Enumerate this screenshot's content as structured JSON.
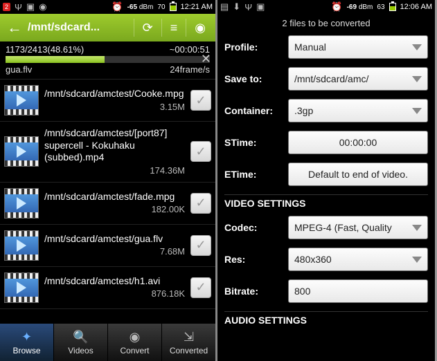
{
  "left": {
    "status": {
      "dbm": "-65",
      "dbm_unit": "dBm",
      "batt_pct": "70",
      "time": "12:21 AM",
      "badge": "2"
    },
    "nav": {
      "path": "/mnt/sdcard..."
    },
    "progress": {
      "count": "1173/2413(48.61%)",
      "eta": "~00:00:51",
      "pct": 48.61
    },
    "current": {
      "name": "gua.flv",
      "rate": "24frame/s"
    },
    "files": [
      {
        "path": "/mnt/sdcard/amctest/Cooke.mpg",
        "size": "3.15M"
      },
      {
        "path": "/mnt/sdcard/amctest/[port87] supercell - Kokuhaku (subbed).mp4",
        "size": "174.36M"
      },
      {
        "path": "/mnt/sdcard/amctest/fade.mpg",
        "size": "182.00K"
      },
      {
        "path": "/mnt/sdcard/amctest/gua.flv",
        "size": "7.68M"
      },
      {
        "path": "/mnt/sdcard/amctest/h1.avi",
        "size": "876.18K"
      }
    ],
    "tabs": {
      "browse": "Browse",
      "videos": "Videos",
      "convert": "Convert",
      "converted": "Converted"
    }
  },
  "right": {
    "status": {
      "dbm": "-69",
      "dbm_unit": "dBm",
      "batt_pct": "63",
      "time": "12:06 AM"
    },
    "header": "2  files to be converted",
    "labels": {
      "profile": "Profile:",
      "saveto": "Save to:",
      "container": "Container:",
      "stime": "STime:",
      "etime": "ETime:",
      "vset": "VIDEO SETTINGS",
      "codec": "Codec:",
      "res": "Res:",
      "bitrate": "Bitrate:",
      "aset": "AUDIO SETTINGS"
    },
    "values": {
      "profile": "Manual",
      "saveto": "/mnt/sdcard/amc/",
      "container": ".3gp",
      "stime": "00:00:00",
      "etime": "Default to end of video.",
      "codec": "MPEG-4 (Fast, Quality",
      "res": "480x360",
      "bitrate": "800"
    }
  }
}
